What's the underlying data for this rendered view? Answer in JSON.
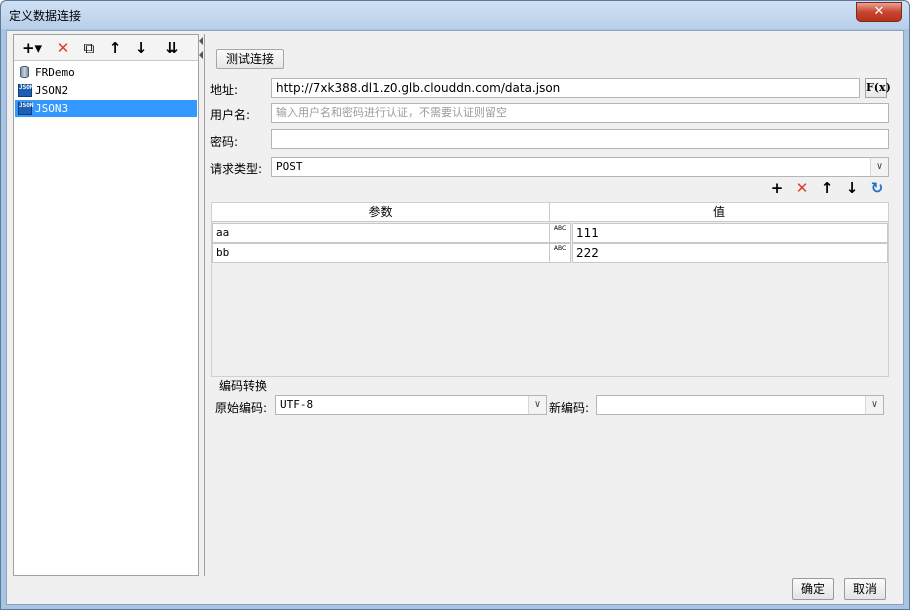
{
  "window": {
    "title": "定义数据连接",
    "close_glyph": "✕"
  },
  "left_toolbar": {
    "add_glyph": "+▾",
    "delete_glyph": "✕",
    "copy_glyph": "⧉",
    "up_glyph": "↑",
    "down_glyph": "↓",
    "sort_glyph": "⇊"
  },
  "connections": [
    {
      "label": "FRDemo",
      "icon": "database-icon",
      "selected": false
    },
    {
      "label": "JSON2",
      "icon": "json-icon",
      "selected": false
    },
    {
      "label": "JSON3",
      "icon": "json-icon",
      "selected": true
    }
  ],
  "json_icon_text": "JSON",
  "test_connection_label": "测试连接",
  "form": {
    "address_label": "地址:",
    "address_value": "http://7xk388.dl1.z0.glb.clouddn.com/data.json",
    "fx_label": "F(x)",
    "username_label": "用户名:",
    "username_placeholder": "输入用户名和密码进行认证，不需要认证则留空",
    "password_label": "密码:",
    "password_value": "",
    "request_type_label": "请求类型:",
    "request_type_value": "POST"
  },
  "param_toolbar": {
    "add_glyph": "+",
    "delete_glyph": "✕",
    "up_glyph": "↑",
    "down_glyph": "↓",
    "refresh_glyph": "↻"
  },
  "params_table": {
    "headers": [
      "参数",
      "值"
    ],
    "type_icon_text": "ABC",
    "rows": [
      {
        "name": "aa",
        "value": "111"
      },
      {
        "name": "bb",
        "value": "222"
      }
    ]
  },
  "encoding": {
    "group_title": "编码转换",
    "original_label": "原始编码:",
    "original_value": "UTF-8",
    "new_label": "新编码:",
    "new_value": ""
  },
  "buttons": {
    "ok": "确定",
    "cancel": "取消"
  },
  "colors": {
    "selection": "#3399ff",
    "delete_red": "#e03b2a",
    "refresh_blue": "#1f6fd1",
    "title_bar": "#b8cfea"
  }
}
